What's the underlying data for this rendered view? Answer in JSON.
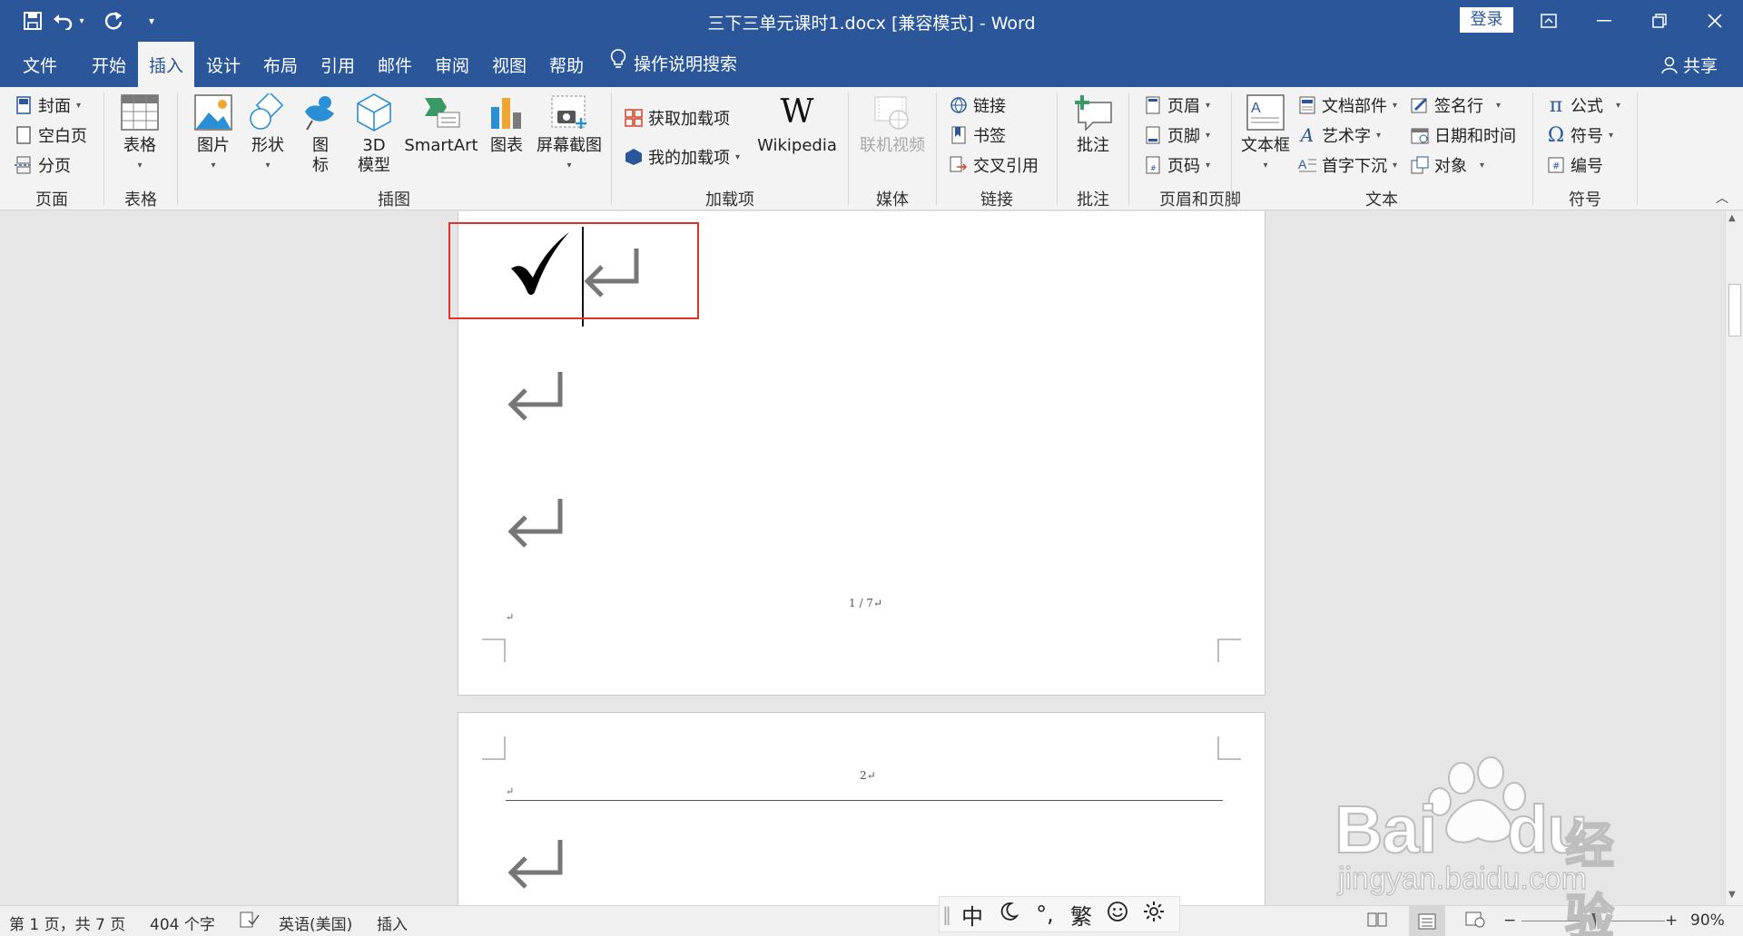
{
  "window": {
    "title": "三下三单元课时1.docx [兼容模式]  -  Word",
    "login": "登录"
  },
  "tabs": {
    "file": "文件",
    "home": "开始",
    "insert": "插入",
    "design": "设计",
    "layout": "布局",
    "references": "引用",
    "mailings": "邮件",
    "review": "审阅",
    "view": "视图",
    "help": "帮助",
    "tell_me": "操作说明搜索",
    "share": "共享"
  },
  "ribbon": {
    "pages": {
      "cover": "封面",
      "blank": "空白页",
      "break": "分页",
      "label": "页面"
    },
    "tables": {
      "table": "表格",
      "label": "表格"
    },
    "illustrations": {
      "picture": "图片",
      "shapes": "形状",
      "icons": "图\n标",
      "icons1": "图",
      "icons2": "标",
      "model3d1": "3D",
      "model3d2": "模型",
      "smartart": "SmartArt",
      "chart": "图表",
      "screenshot": "屏幕截图",
      "label": "插图"
    },
    "addins": {
      "get": "获取加载项",
      "my": "我的加载项",
      "wikipedia": "Wikipedia",
      "label": "加载项"
    },
    "media": {
      "online_video": "联机视频",
      "label": "媒体"
    },
    "links": {
      "link": "链接",
      "bookmark": "书签",
      "crossref": "交叉引用",
      "label": "链接"
    },
    "comments": {
      "comment": "批注",
      "label": "批注"
    },
    "header_footer": {
      "header": "页眉",
      "footer": "页脚",
      "page_number": "页码",
      "label": "页眉和页脚"
    },
    "text": {
      "textbox": "文本框",
      "quick_parts": "文档部件",
      "wordart": "艺术字",
      "dropcap": "首字下沉",
      "signature": "签名行",
      "datetime": "日期和时间",
      "object": "对象",
      "label": "文本"
    },
    "symbols": {
      "equation": "公式",
      "symbol": "符号",
      "numbering": "编号",
      "label": "符号"
    }
  },
  "document": {
    "check_mark": "✓",
    "footer_page": "1 / 7↵",
    "header_page2": "2↵",
    "small_para": "↵"
  },
  "status": {
    "page": "第 1 页，共 7 页",
    "words": "404 个字",
    "language": "英语(美国)",
    "mode": "插入",
    "zoom": "90%",
    "zoom_fraction": 0.5
  },
  "ime": {
    "lang": "中",
    "punct": "°,",
    "trad": "繁"
  },
  "watermark": {
    "brand": "Bai",
    "brand2": "du",
    "jingyan": "经验",
    "url": "jingyan.baidu.com"
  },
  "colors": {
    "accent": "#2b579a",
    "highlight_box": "#e0302f"
  }
}
